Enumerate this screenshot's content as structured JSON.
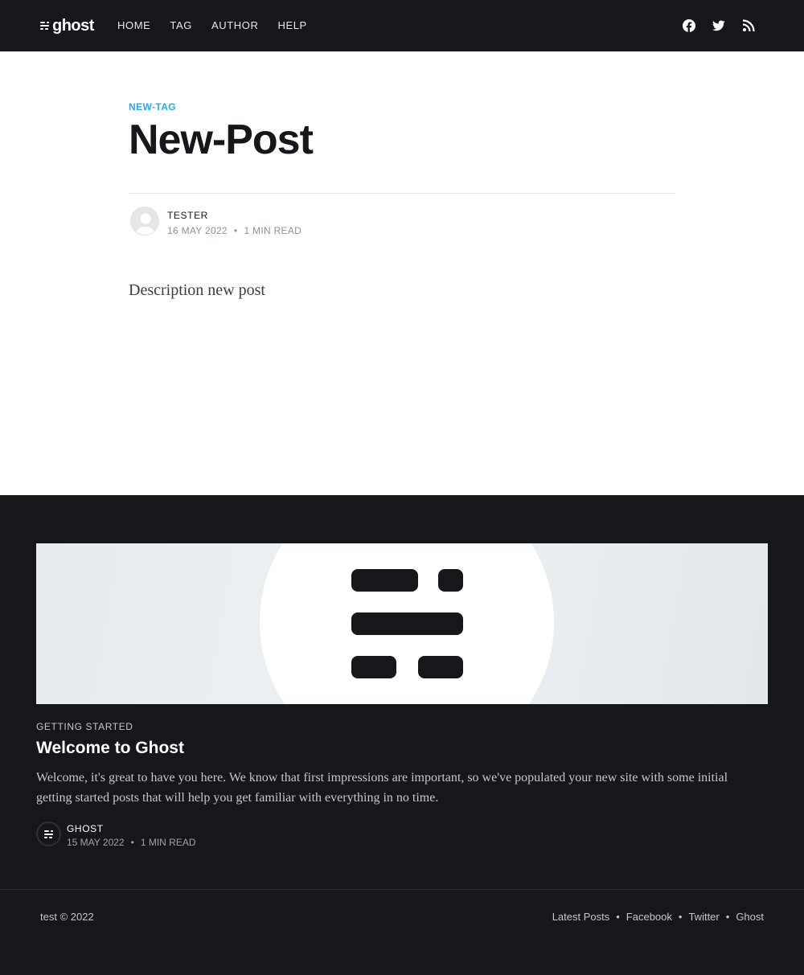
{
  "header": {
    "logo_text": "ghost",
    "nav": [
      "HOME",
      "TAG",
      "AUTHOR",
      "HELP"
    ],
    "social_icons": [
      "facebook-icon",
      "twitter-icon",
      "rss-icon"
    ]
  },
  "article": {
    "tag": "NEW-TAG",
    "title": "New-Post",
    "author": "TESTER",
    "date": "16 MAY 2022",
    "separator": "•",
    "reading_time": "1 MIN READ",
    "excerpt": "Description new post"
  },
  "read_next": {
    "tag": "GETTING STARTED",
    "title": "Welcome to Ghost",
    "excerpt": "Welcome, it's great to have you here. We know that first impressions are important, so we've populated your new site with some initial getting started posts that will help you get familiar with everything in no time.",
    "author": "GHOST",
    "date": "15 MAY 2022",
    "separator": "•",
    "reading_time": "1 MIN READ"
  },
  "footer": {
    "copyright": "test © 2022",
    "links": [
      "Latest Posts",
      "Facebook",
      "Twitter",
      "Ghost"
    ],
    "separator": "•"
  },
  "colors": {
    "header_bg": "#15171a",
    "accent": "#26a8ed"
  }
}
